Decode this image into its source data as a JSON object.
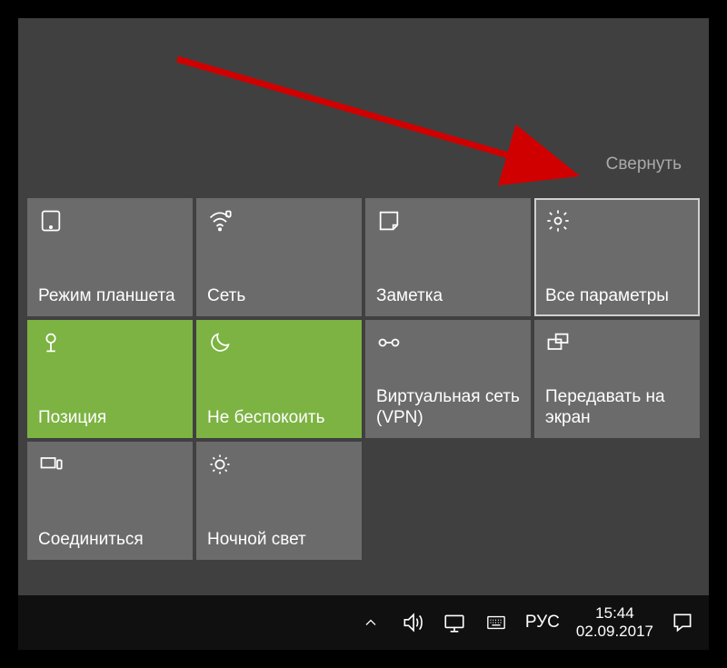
{
  "collapse_label": "Свернуть",
  "tiles": [
    {
      "label": "Режим планшета",
      "name": "tile-tablet-mode",
      "icon": "tablet-icon",
      "active": false,
      "highlighted": false
    },
    {
      "label": "Сеть",
      "name": "tile-network",
      "icon": "wifi-icon",
      "active": false,
      "highlighted": false
    },
    {
      "label": "Заметка",
      "name": "tile-note",
      "icon": "note-icon",
      "active": false,
      "highlighted": false
    },
    {
      "label": "Все параметры",
      "name": "tile-all-settings",
      "icon": "gear-icon",
      "active": false,
      "highlighted": true
    },
    {
      "label": "Позиция",
      "name": "tile-location",
      "icon": "location-icon",
      "active": true,
      "highlighted": false
    },
    {
      "label": "Не беспокоить",
      "name": "tile-quiet-hours",
      "icon": "moon-icon",
      "active": true,
      "highlighted": false
    },
    {
      "label": "Виртуальная сеть (VPN)",
      "name": "tile-vpn",
      "icon": "vpn-icon",
      "active": false,
      "highlighted": false
    },
    {
      "label": "Передавать на экран",
      "name": "tile-project",
      "icon": "project-icon",
      "active": false,
      "highlighted": false
    },
    {
      "label": "Соединиться",
      "name": "tile-connect",
      "icon": "connect-icon",
      "active": false,
      "highlighted": false
    },
    {
      "label": "Ночной свет",
      "name": "tile-night-light",
      "icon": "night-light-icon",
      "active": false,
      "highlighted": false
    }
  ],
  "taskbar": {
    "language": "РУС",
    "time": "15:44",
    "date": "02.09.2017"
  }
}
